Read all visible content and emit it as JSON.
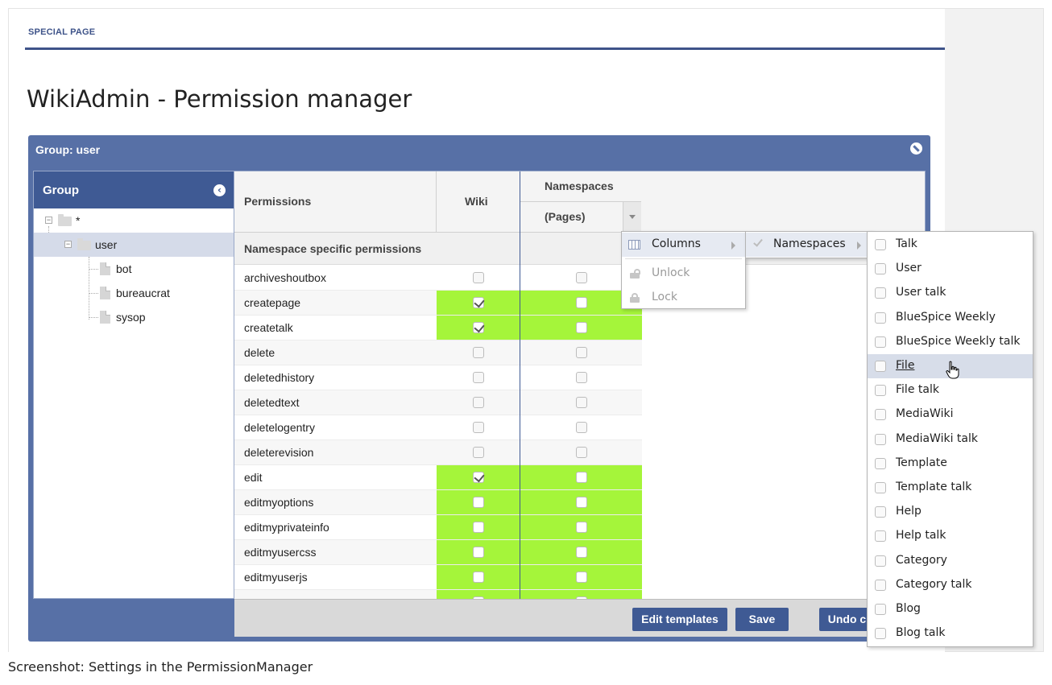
{
  "page": {
    "special_label": "SPECIAL PAGE",
    "title": "WikiAdmin - Permission manager",
    "caption": "Screenshot: Settings in the PermissionManager"
  },
  "panel": {
    "title": "Group: user",
    "close_icon": "close-circle-icon"
  },
  "group_panel": {
    "header": "Group",
    "collapse_icon": "collapse-left-icon",
    "tree": [
      {
        "label": "*",
        "level": 0,
        "type": "folder"
      },
      {
        "label": "user",
        "level": 1,
        "type": "folder",
        "selected": true
      },
      {
        "label": "bot",
        "level": 2,
        "type": "leaf"
      },
      {
        "label": "bureaucrat",
        "level": 2,
        "type": "leaf"
      },
      {
        "label": "sysop",
        "level": 2,
        "type": "leaf"
      }
    ]
  },
  "grid": {
    "col_permissions": "Permissions",
    "col_wiki": "Wiki",
    "col_namespaces": "Namespaces",
    "col_pages": "(Pages)",
    "group_header": "Namespace specific permissions",
    "rows": [
      {
        "name": "archiveshoutbox",
        "wiki": false,
        "pages": false,
        "green": false
      },
      {
        "name": "createpage",
        "wiki": true,
        "pages": false,
        "green": true
      },
      {
        "name": "createtalk",
        "wiki": true,
        "pages": false,
        "green": true
      },
      {
        "name": "delete",
        "wiki": false,
        "pages": false,
        "green": false
      },
      {
        "name": "deletedhistory",
        "wiki": false,
        "pages": false,
        "green": false
      },
      {
        "name": "deletedtext",
        "wiki": false,
        "pages": false,
        "green": false
      },
      {
        "name": "deletelogentry",
        "wiki": false,
        "pages": false,
        "green": false
      },
      {
        "name": "deleterevision",
        "wiki": false,
        "pages": false,
        "green": false
      },
      {
        "name": "edit",
        "wiki": true,
        "pages": false,
        "green": true
      },
      {
        "name": "editmyoptions",
        "wiki": false,
        "pages": false,
        "green": true
      },
      {
        "name": "editmyprivateinfo",
        "wiki": false,
        "pages": false,
        "green": true
      },
      {
        "name": "editmyusercss",
        "wiki": false,
        "pages": false,
        "green": true
      },
      {
        "name": "editmyuserjs",
        "wiki": false,
        "pages": false,
        "green": true
      },
      {
        "name": "",
        "wiki": false,
        "pages": false,
        "green": true
      }
    ]
  },
  "footer": {
    "edit_templates": "Edit templates",
    "save": "Save",
    "undo": "Undo changes"
  },
  "column_menu": {
    "columns": "Columns",
    "unlock": "Unlock",
    "lock": "Lock"
  },
  "namespace_menu": {
    "namespaces": "Namespaces"
  },
  "ns_list": {
    "items": [
      "Talk",
      "User",
      "User talk",
      "BlueSpice Weekly",
      "BlueSpice Weekly talk",
      "File",
      "File talk",
      "MediaWiki",
      "MediaWiki talk",
      "Template",
      "Template talk",
      "Help",
      "Help talk",
      "Category",
      "Category talk",
      "Blog",
      "Blog talk"
    ],
    "highlighted": "File"
  },
  "colors": {
    "brand": "#3f5a94",
    "panel": "#5770a6",
    "allowed": "#a5f53a"
  }
}
